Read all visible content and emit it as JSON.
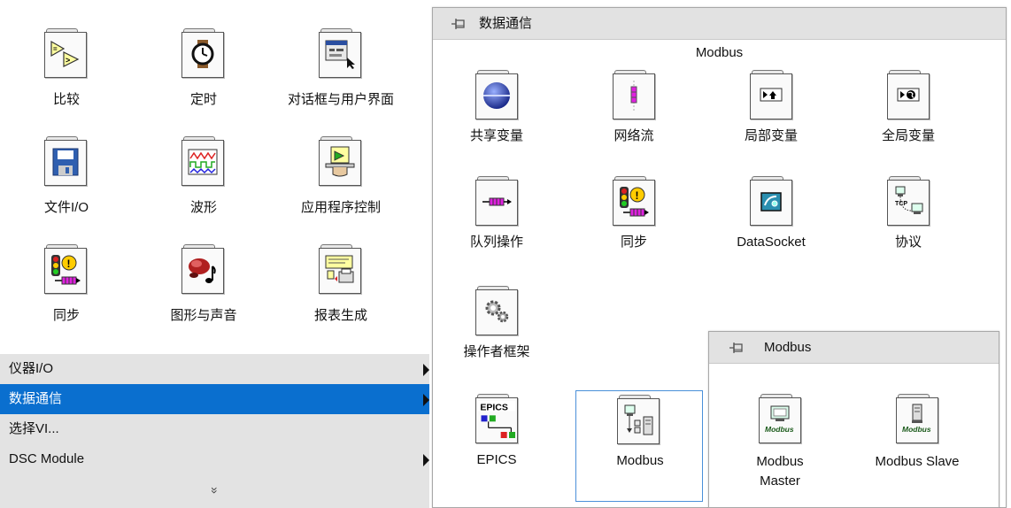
{
  "left_palette": {
    "items": [
      {
        "label": "比较",
        "icon": "compare-icon"
      },
      {
        "label": "定时",
        "icon": "timing-icon"
      },
      {
        "label": "对话框与用户界面",
        "icon": "dialog-ui-icon"
      },
      {
        "label": "文件I/O",
        "icon": "file-io-icon"
      },
      {
        "label": "波形",
        "icon": "waveform-icon"
      },
      {
        "label": "应用程序控制",
        "icon": "app-control-icon"
      },
      {
        "label": "同步",
        "icon": "sync-icon"
      },
      {
        "label": "图形与声音",
        "icon": "graphics-sound-icon"
      },
      {
        "label": "报表生成",
        "icon": "report-icon"
      }
    ],
    "menu": [
      {
        "label": "仪器I/O",
        "has_submenu": true,
        "active": false
      },
      {
        "label": "数据通信",
        "has_submenu": true,
        "active": true
      },
      {
        "label": "选择VI...",
        "has_submenu": false,
        "active": false
      },
      {
        "label": "DSC Module",
        "has_submenu": true,
        "active": false
      }
    ],
    "more_glyph": "»"
  },
  "comm_palette": {
    "title": "数据通信",
    "subtitle": "Modbus",
    "items": [
      {
        "label": "共享变量",
        "icon": "shared-variable-icon"
      },
      {
        "label": "网络流",
        "icon": "network-stream-icon"
      },
      {
        "label": "局部变量",
        "icon": "local-variable-icon"
      },
      {
        "label": "全局变量",
        "icon": "global-variable-icon"
      },
      {
        "label": "队列操作",
        "icon": "queue-icon"
      },
      {
        "label": "同步",
        "icon": "sync-icon"
      },
      {
        "label": "DataSocket",
        "icon": "datasocket-icon"
      },
      {
        "label": "协议",
        "icon": "protocol-icon"
      },
      {
        "label": "操作者框架",
        "icon": "actor-framework-icon"
      },
      {
        "label": "EPICS",
        "icon": "epics-icon",
        "icon_text": "EPICS"
      },
      {
        "label": "Modbus",
        "icon": "modbus-icon",
        "selected": true
      }
    ]
  },
  "modbus_palette": {
    "title": "Modbus",
    "items": [
      {
        "label_line1": "Modbus",
        "label_line2": "Master",
        "icon": "modbus-master-icon",
        "icon_text": "Modbus"
      },
      {
        "label_line1": "Modbus Slave",
        "label_line2": "",
        "icon": "modbus-slave-icon",
        "icon_text": "Modbus"
      }
    ]
  },
  "colors": {
    "menu_active": "#0a6fcf",
    "menu_bg": "#e3e3e3",
    "header_bg": "#e2e2e2",
    "selection_border": "#4a90d9"
  }
}
